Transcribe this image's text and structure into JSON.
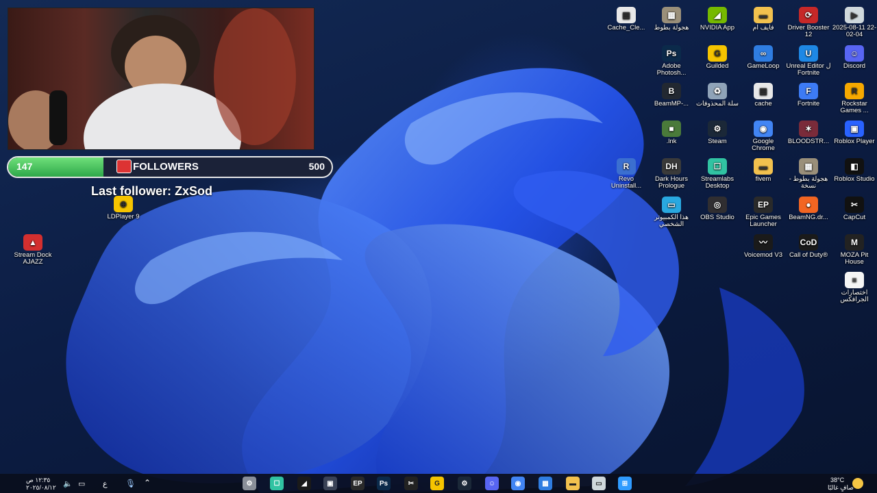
{
  "overlay": {
    "followers_current": "147",
    "followers_goal": "500",
    "followers_label": "FOLLOWERS",
    "progress_fraction": 0.294,
    "last_follower": "Last follower: ZxSod"
  },
  "desktop_icons": [
    {
      "id": "cache-clean",
      "label": "Cache_Cle...",
      "icon": "file-icon",
      "color": "#e8e8e8"
    },
    {
      "id": "tour-1",
      "label": "هجولة بطوط",
      "icon": "image-icon",
      "color": "#9a8f7a"
    },
    {
      "id": "nvidia",
      "label": "NVIDIA App",
      "icon": "nvidia-icon",
      "color": "#76b900"
    },
    {
      "id": "five-m",
      "label": "فايف ام",
      "icon": "folder-icon",
      "color": "#f2c14e"
    },
    {
      "id": "driver-booster",
      "label": "Driver Booster 12",
      "icon": "driver-booster-icon",
      "color": "#c62828"
    },
    {
      "id": "date-file",
      "label": "2025-08-11 22-02-04",
      "icon": "video-file-icon",
      "color": "#cfd8dc"
    },
    {
      "id": "photoshop",
      "label": "Adobe Photosh...",
      "icon": "photoshop-icon",
      "color": "#0b2a4a"
    },
    {
      "id": "guilded",
      "label": "Guilded",
      "icon": "guilded-icon",
      "color": "#f5c400"
    },
    {
      "id": "gameloop",
      "label": "GameLoop",
      "icon": "gameloop-icon",
      "color": "#2f7de1"
    },
    {
      "id": "unreal-fortnite",
      "label": "Unreal Editor ل Fortnite",
      "icon": "unreal-icon",
      "color": "#1e88e5"
    },
    {
      "id": "discord",
      "label": "Discord",
      "icon": "discord-icon",
      "color": "#5865f2"
    },
    {
      "id": "beammp",
      "label": "BeamMP-...",
      "icon": "beammp-icon",
      "color": "#222831"
    },
    {
      "id": "recycle-bin",
      "label": "سلة المحذوفات",
      "icon": "recycle-bin-icon",
      "color": "#8fa3b8"
    },
    {
      "id": "cache",
      "label": "cache",
      "icon": "file-icon",
      "color": "#e8e8e8"
    },
    {
      "id": "fortnite",
      "label": "Fortnite",
      "icon": "fortnite-icon",
      "color": "#3d7bf5"
    },
    {
      "id": "rockstar",
      "label": "Rockstar Games ...",
      "icon": "rockstar-icon",
      "color": "#f6a800"
    },
    {
      "id": "lnk",
      "label": ".lnk",
      "icon": "game-icon",
      "color": "#4a7a3a"
    },
    {
      "id": "steam",
      "label": "Steam",
      "icon": "steam-icon",
      "color": "#1b2838"
    },
    {
      "id": "chrome",
      "label": "Google Chrome",
      "icon": "chrome-icon",
      "color": "#4285f4"
    },
    {
      "id": "bloodstrike",
      "label": "BLOODSTR...",
      "icon": "bloodstrike-icon",
      "color": "#7a2b3a"
    },
    {
      "id": "roblox-player",
      "label": "Roblox Player",
      "icon": "roblox-icon",
      "color": "#2962ff"
    },
    {
      "id": "revo",
      "label": "Revo Uninstall...",
      "icon": "revo-icon",
      "color": "#3b6fd0"
    },
    {
      "id": "dark-hours",
      "label": "Dark Hours Prologue",
      "icon": "dark-hours-icon",
      "color": "#3a3a3a"
    },
    {
      "id": "streamlabs",
      "label": "Streamlabs Desktop",
      "icon": "streamlabs-icon",
      "color": "#31c3a2"
    },
    {
      "id": "fivem",
      "label": "fivem",
      "icon": "folder-icon",
      "color": "#f2c14e"
    },
    {
      "id": "tour-copy",
      "label": "هجولة بطوط - نسخة",
      "icon": "image-icon",
      "color": "#9a8f7a"
    },
    {
      "id": "roblox-studio",
      "label": "Roblox Studio",
      "icon": "roblox-studio-icon",
      "color": "#111111"
    },
    {
      "id": "this-pc",
      "label": "هذا الكمبيوتر الشخصي",
      "icon": "this-pc-icon",
      "color": "#29a8e0"
    },
    {
      "id": "obs",
      "label": "OBS Studio",
      "icon": "obs-icon",
      "color": "#302e31"
    },
    {
      "id": "epic",
      "label": "Epic Games Launcher",
      "icon": "epic-icon",
      "color": "#2a2a2a"
    },
    {
      "id": "beamng",
      "label": "BeamNG.dr...",
      "icon": "beamng-icon",
      "color": "#f26522"
    },
    {
      "id": "capcut",
      "label": "CapCut",
      "icon": "capcut-icon",
      "color": "#111111"
    },
    {
      "id": "voicemod",
      "label": "Voicemod V3",
      "icon": "voicemod-icon",
      "color": "#1a1a1a"
    },
    {
      "id": "cod",
      "label": "Call of Duty®",
      "icon": "call-of-duty-icon",
      "color": "#1a1a1a"
    },
    {
      "id": "moza",
      "label": "MOZA Pit House",
      "icon": "moza-icon",
      "color": "#222222"
    },
    {
      "id": "graphics-shortcuts",
      "label": "اختصارات الجرافكس",
      "icon": "text-file-icon",
      "color": "#f5f5f5"
    },
    {
      "id": "ldplayer",
      "label": "LDPlayer 9",
      "icon": "ldplayer-icon",
      "color": "#f5c400"
    },
    {
      "id": "stream-dock",
      "label": "Stream Dock AJAZZ",
      "icon": "stream-dock-icon",
      "color": "#d32f2f"
    }
  ],
  "taskbar": {
    "apps": [
      {
        "name": "settings-icon",
        "color": "#8a8f99"
      },
      {
        "name": "streamlabs-icon",
        "color": "#31c3a2"
      },
      {
        "name": "nvidia-icon",
        "color": "#1a1a1a"
      },
      {
        "name": "app-icon",
        "color": "#3a4256"
      },
      {
        "name": "epic-icon",
        "color": "#2a2a2a"
      },
      {
        "name": "photoshop-icon",
        "color": "#0b2a4a"
      },
      {
        "name": "capcut-icon",
        "color": "#222222"
      },
      {
        "name": "guilded-icon",
        "color": "#f5c400"
      },
      {
        "name": "steam-icon",
        "color": "#1b2838"
      },
      {
        "name": "discord-icon",
        "color": "#5865f2"
      },
      {
        "name": "chrome-icon",
        "color": "#4285f4"
      },
      {
        "name": "store-icon",
        "color": "#2f7de1"
      },
      {
        "name": "file-explorer-icon",
        "color": "#f2c14e"
      },
      {
        "name": "task-view-icon",
        "color": "#cfd8dc"
      },
      {
        "name": "windows-start-icon",
        "color": "#2f9bff"
      }
    ],
    "weather_temp": "38°C",
    "weather_text": "صافٍ غالبًا",
    "time": "١٢:٣٥ ص",
    "date": "٢٠٢٥/٠٨/١٢",
    "lang": "ع"
  }
}
